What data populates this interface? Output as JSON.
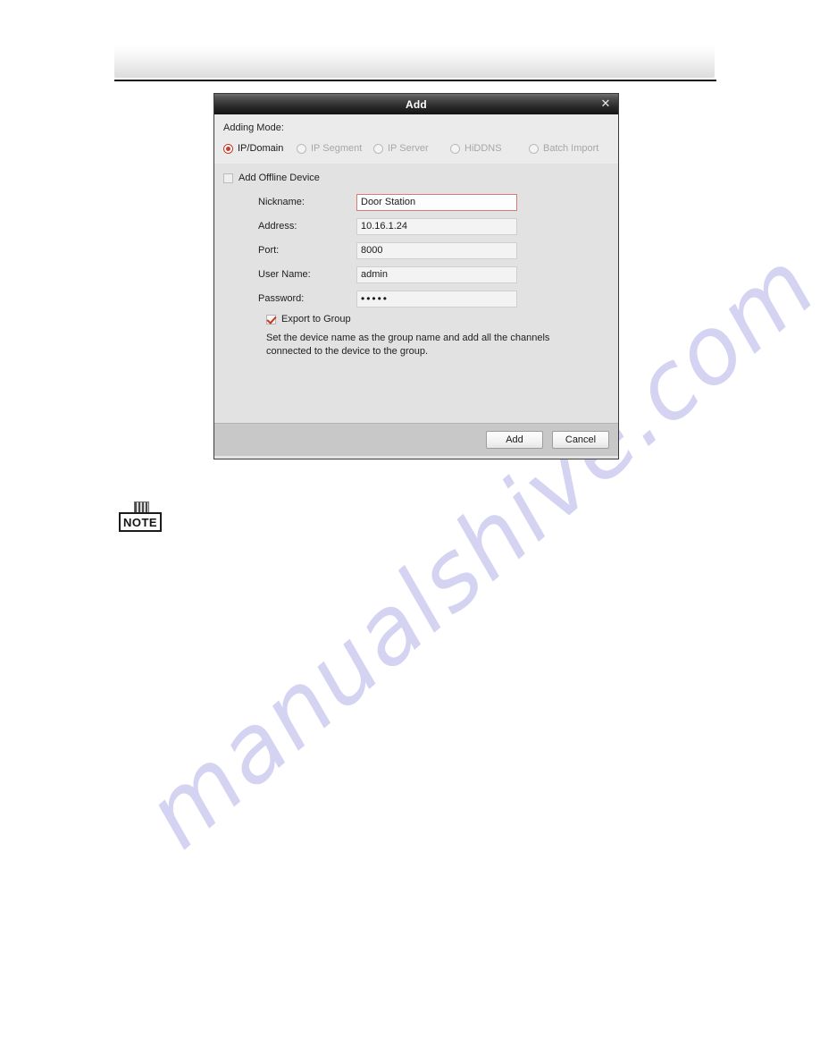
{
  "page": {
    "watermark": "manualshive.com"
  },
  "dialog": {
    "title": "Add",
    "close_icon": "close-icon",
    "adding_mode": {
      "label": "Adding Mode:",
      "options": [
        {
          "label": "IP/Domain",
          "selected": true,
          "enabled": true
        },
        {
          "label": "IP Segment",
          "selected": false,
          "enabled": false
        },
        {
          "label": "IP Server",
          "selected": false,
          "enabled": false
        },
        {
          "label": "HiDDNS",
          "selected": false,
          "enabled": false
        },
        {
          "label": "Batch Import",
          "selected": false,
          "enabled": false
        }
      ]
    },
    "offline_device": {
      "label": "Add Offline Device",
      "checked": false
    },
    "fields": [
      {
        "label": "Nickname:",
        "value": "Door Station",
        "focused": true,
        "type": "text"
      },
      {
        "label": "Address:",
        "value": "10.16.1.24",
        "focused": false,
        "type": "text"
      },
      {
        "label": "Port:",
        "value": "8000",
        "focused": false,
        "type": "text"
      },
      {
        "label": "User Name:",
        "value": "admin",
        "focused": false,
        "type": "text"
      },
      {
        "label": "Password:",
        "value": "•••••",
        "focused": false,
        "type": "password"
      }
    ],
    "export_to_group": {
      "label": "Export to Group",
      "checked": true
    },
    "hint": "Set the device name as the group name and add all the channels connected to the device to the group.",
    "buttons": {
      "add": "Add",
      "cancel": "Cancel"
    }
  },
  "note": {
    "label": "NOTE"
  },
  "colors": {
    "accent_red": "#cf3b2c",
    "titlebar_dark": "#141414",
    "dialog_body": "#e2e2e2",
    "footer": "#c8c8c8",
    "watermark": "#c9c7ee"
  }
}
